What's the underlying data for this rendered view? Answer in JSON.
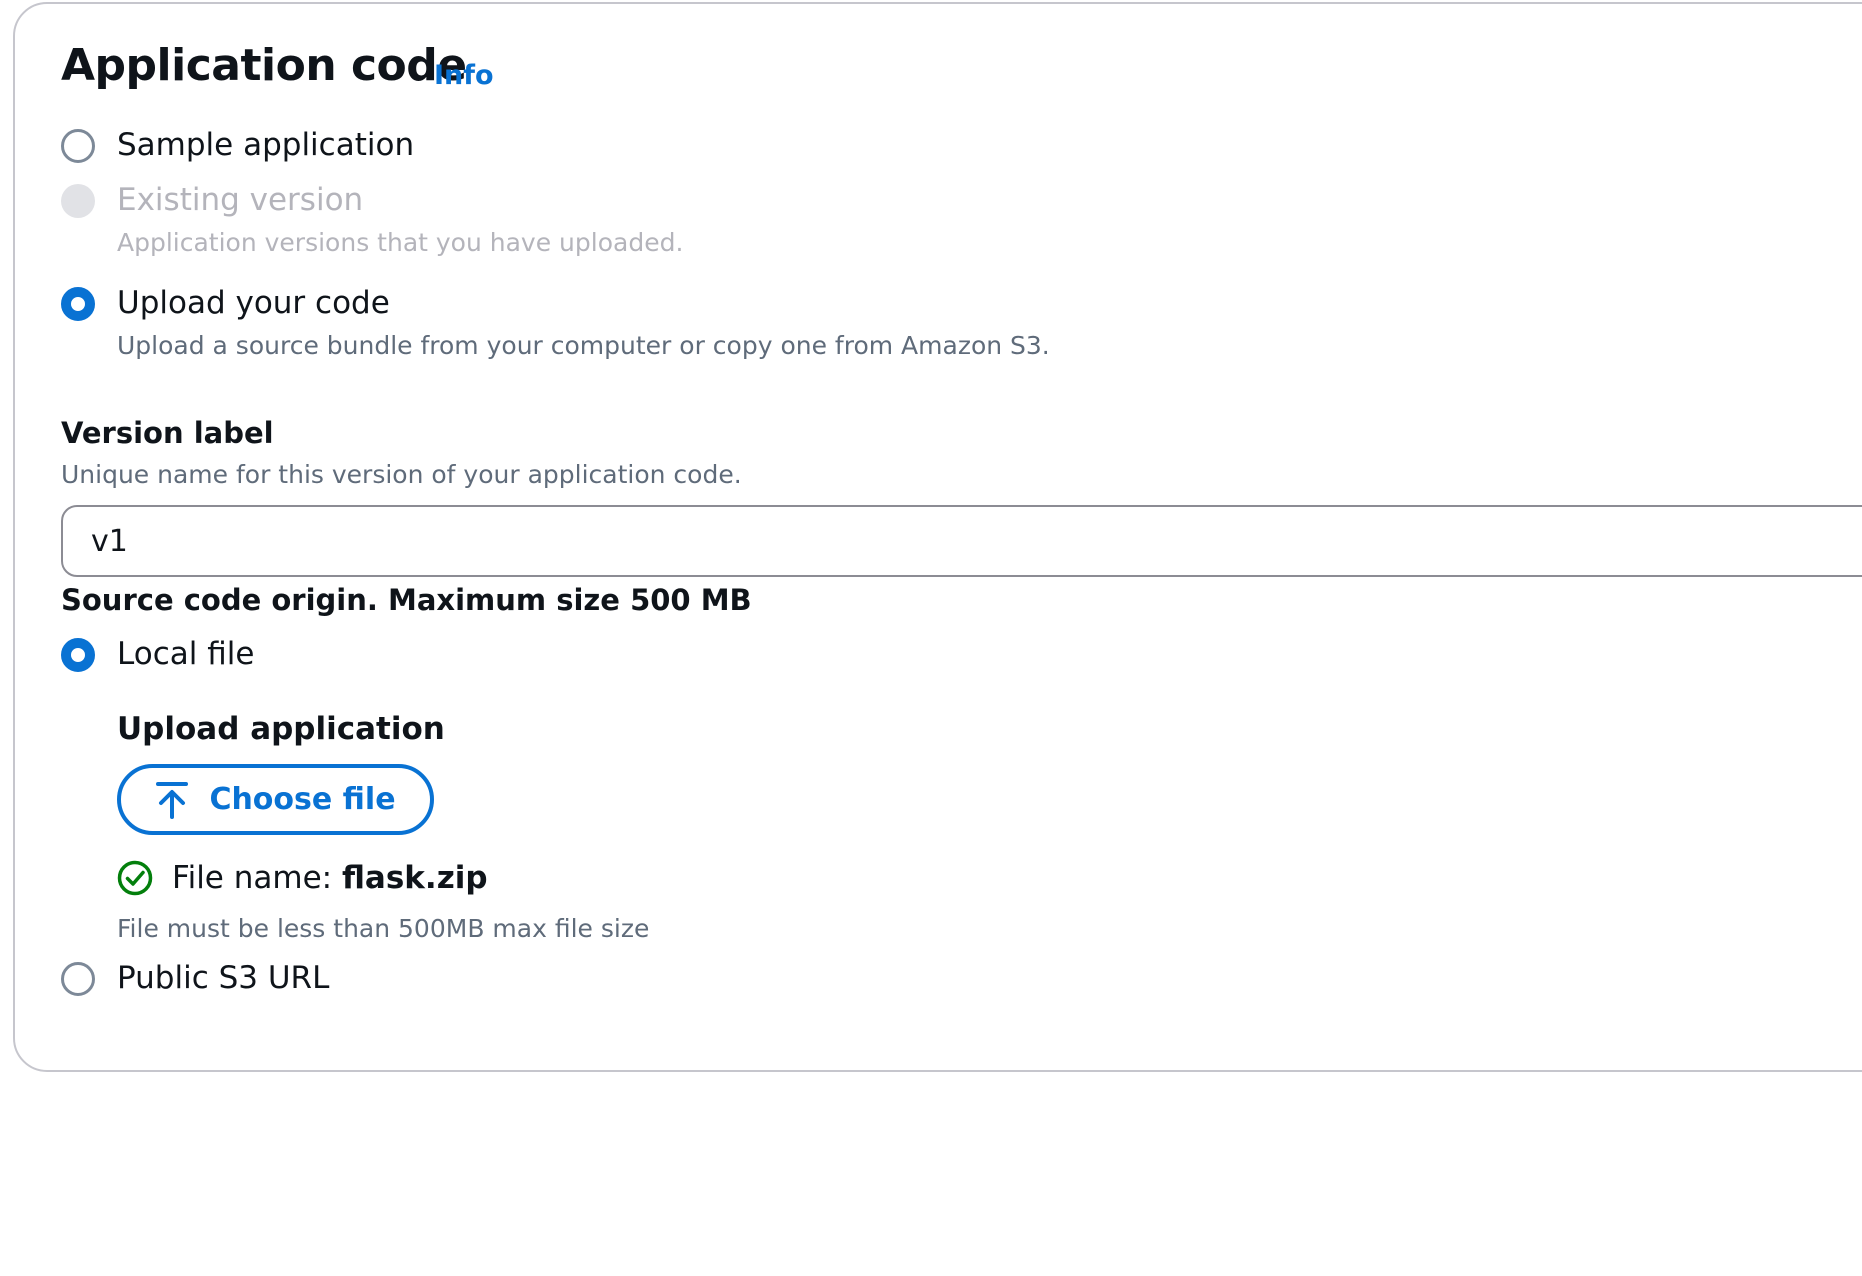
{
  "section": {
    "title": "Application code",
    "info_link": "Info"
  },
  "app_code_options": [
    {
      "label": "Sample application",
      "description": "",
      "state": "unchecked"
    },
    {
      "label": "Existing version",
      "description": "Application versions that you have uploaded.",
      "state": "disabled"
    },
    {
      "label": "Upload your code",
      "description": "Upload a source bundle from your computer or copy one from Amazon S3.",
      "state": "checked"
    }
  ],
  "version_label": {
    "label": "Version label",
    "description": "Unique name for this version of your application code.",
    "value": "v1"
  },
  "source_origin": {
    "label": "Source code origin. Maximum size 500 MB",
    "options": [
      {
        "label": "Local file",
        "state": "checked"
      },
      {
        "label": "Public S3 URL",
        "state": "unchecked"
      }
    ]
  },
  "upload": {
    "label": "Upload application",
    "button_label": "Choose file",
    "file_name_prefix": "File name: ",
    "file_name": "flask.zip",
    "constraint": "File must be less than 500MB max file size"
  },
  "colors": {
    "accent": "#0972d3",
    "success": "#037f0c",
    "disabled": "#b4b4bb"
  }
}
